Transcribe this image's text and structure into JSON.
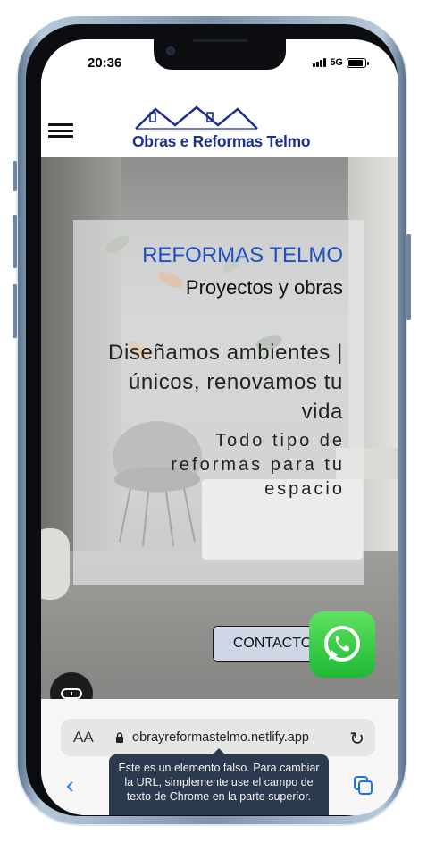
{
  "status_bar": {
    "time": "20:36",
    "network": "5G",
    "signal_bars": 4,
    "battery_level": 0.9
  },
  "header": {
    "menu_icon": "hamburger-icon",
    "logo_text": "Obras e Reformas Telmo",
    "logo_icon": "house-roofs-icon",
    "logo_color": "#1f2f8c"
  },
  "hero": {
    "brand": "REFORMAS TELMO",
    "subtitle": "Proyectos y obras",
    "tagline": "Diseñamos ambientes | únicos, renovamos tu vida",
    "description": "Todo tipo de reformas para tu espacio",
    "brand_color": "#1f4fc6",
    "contact_label": "CONTACTO",
    "whatsapp_icon": "whatsapp-icon",
    "accessibility_icon": "accessibility-widget-icon"
  },
  "browser": {
    "text_size_label": "AA",
    "url": "obrayreformastelmo.netlify.app",
    "lock_icon": "lock-icon",
    "reload_icon": "reload-icon",
    "back_icon": "chevron-left-icon",
    "tabs_icon": "tabs-icon",
    "tooltip": "Este es un elemento falso. Para cambiar la URL, simplemente use el campo de texto de Chrome en la parte superior."
  }
}
